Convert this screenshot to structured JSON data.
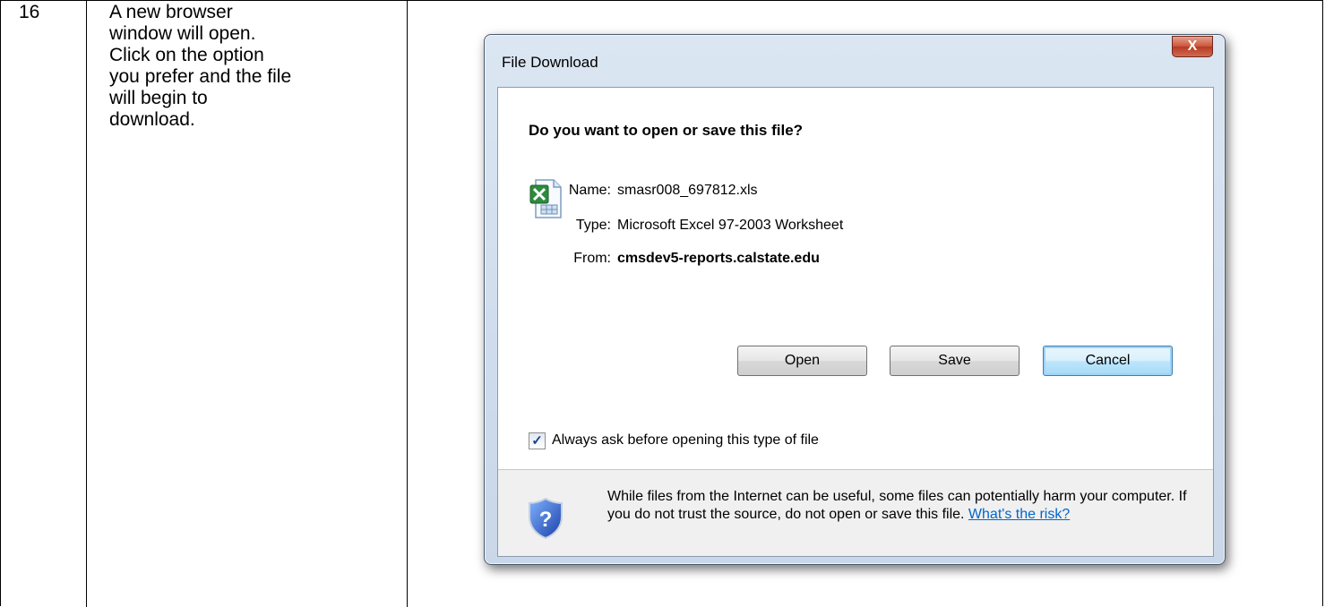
{
  "step": {
    "number": "16",
    "instruction": "A new browser\nwindow will open.\nClick on the option\nyou prefer and the file\nwill begin to\ndownload."
  },
  "dialog": {
    "title": "File Download",
    "close_label": "X",
    "question": "Do you want to open or save this file?",
    "file_icon": "excel-file-icon",
    "info": {
      "name_label": "Name:",
      "name_value": "smasr008_697812.xls",
      "type_label": "Type:",
      "type_value": "Microsoft Excel 97-2003 Worksheet",
      "from_label": "From:",
      "from_value": "cmsdev5-reports.calstate.edu"
    },
    "buttons": {
      "open": "Open",
      "save": "Save",
      "cancel": "Cancel"
    },
    "always_ask": {
      "checked": true,
      "label": "Always ask before opening this type of file"
    },
    "footer": {
      "icon": "security-shield-question-icon",
      "warning_text": "While files from the Internet can be useful, some files can potentially harm your computer. If you do not trust the source, do not open or save this file.",
      "risk_link": "What's the risk?"
    }
  }
}
